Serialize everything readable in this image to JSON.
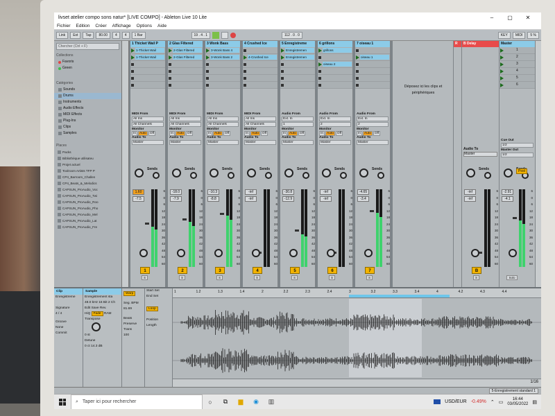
{
  "window": {
    "title": "livset atelier compo sons natur* [LIVE COMPO] - Ableton Live 10 Lite",
    "minimize": "–",
    "maximize": "▢",
    "close": "✕"
  },
  "menu": [
    "Fichier",
    "Edition",
    "Créer",
    "Affichage",
    "Options",
    "Aide"
  ],
  "control_bar": {
    "link": "Link",
    "ext": "Ext",
    "tap": "Tap",
    "tempo": "80.00",
    "sig_num": "4",
    "sig_den": "4",
    "quant": "1 Bar",
    "position": "19 . 4 . 1",
    "loop_start": "112 . 0 . 0",
    "key": "KEY",
    "midi": "MIDI",
    "cpu": "5 %"
  },
  "browser": {
    "search_placeholder": "Chercher (Ctrl + F)",
    "collections_label": "Collections",
    "collections": [
      {
        "label": "Favoris",
        "color": "#e04646"
      },
      {
        "label": "Green",
        "color": "#3cbf4a"
      }
    ],
    "categories_label": "Catégories",
    "categories": [
      "Sounds",
      "Drums",
      "Instruments",
      "Audio Effects",
      "MIDI Effects",
      "Plug-Ins",
      "Clips",
      "Samples"
    ],
    "selected_category": "Drums",
    "places_label": "Places",
    "places": [
      "Packs",
      "Bibliothèque utilisateu",
      "Projet actuel",
      "Toolroom Artists TFP P",
      "CP4_Barroom_Challen",
      "CP4_Beats_&_Melodics",
      "CAPSUN_ProAudio_Voc",
      "CAPSUN_ProAudio_Twi",
      "CAPSUN_ProAudio_Roo",
      "CAPSUN_ProAudio_Pho",
      "CAPSUN_ProAudio_Mel",
      "CAPSUN_ProAudio_Lat",
      "CAPSUN_ProAudio_Fre"
    ]
  },
  "tracks": [
    {
      "name": "1 Thicket Wail P",
      "color": "#8ccbe8",
      "clips": [
        "1-Thicket Wail",
        "1-Thicket Wail"
      ],
      "io_label": "MIDI From",
      "io_from": "All Ins",
      "io_ch": "All Channels",
      "vol": "1.60",
      "vol2": "-7.5",
      "num": "1",
      "meter": 0.52
    },
    {
      "name": "2 Glas Filtered",
      "color": "#8ccbe8",
      "clips": [
        "2-Glas Filtered",
        "2-Glas Filtered"
      ],
      "io_label": "MIDI From",
      "io_from": "All Ins",
      "io_ch": "All Channels",
      "vol": "-18.0",
      "vol2": "-7.9",
      "num": "2",
      "meter": 0.58
    },
    {
      "name": "3 Wonk Bass",
      "color": "#8ccbe8",
      "clips": [
        "3-Wonk Bass 4",
        "3-Wonk Bass 2"
      ],
      "io_label": "MIDI From",
      "io_from": "All Ins",
      "io_ch": "All Channels",
      "vol": "-10.3",
      "vol2": "-8.8",
      "num": "3",
      "meter": 0.66
    },
    {
      "name": "4 Crushed Ice",
      "color": "#8ccbe8",
      "clips": [
        "",
        "4-Crushed Ice"
      ],
      "io_label": "MIDI From",
      "io_from": "All Ins",
      "io_ch": "All Channels",
      "vol": "-inf",
      "vol2": "-inf",
      "num": "4",
      "meter": 0
    },
    {
      "name": "5 Enregistreme",
      "color": "#8ccbe8",
      "clips": [
        "Enregistremen",
        "Enregistremen"
      ],
      "io_label": "Audio From",
      "io_from": "Ext. In",
      "io_ch": "1",
      "vol": "-30.8",
      "vol2": "-12.9",
      "num": "5",
      "meter": 0.42
    },
    {
      "name": "6 grillons",
      "color": "#8ccbe8",
      "clips": [
        "grillons",
        "",
        "oiseau 2"
      ],
      "io_label": "Audio From",
      "io_from": "Ext. In",
      "io_ch": "2",
      "vol": "-inf",
      "vol2": "-inf",
      "num": "6",
      "meter": 0
    },
    {
      "name": "7 oiseau 1",
      "color": "#8ccbe8",
      "clips": [
        "",
        "oiseau 1"
      ],
      "io_label": "Audio From",
      "io_from": "Ext. In",
      "io_ch": "2",
      "vol": "-4.65",
      "vol2": "-3.4",
      "num": "7",
      "meter": 0.7
    }
  ],
  "drop_hint": "Déposez ici les clips et périphériques",
  "returns": [
    {
      "name": "B Delay",
      "color": "#e84b4b",
      "vol": "-inf",
      "vol2": "-inf",
      "letter": "B"
    },
    {
      "name": "Master",
      "color": "#8ccbe8",
      "vol": "-2.91",
      "vol2": "-4.1",
      "letter": ""
    }
  ],
  "monitor": {
    "label": "Monitor",
    "in": "In",
    "auto": "Auto",
    "off": "Off",
    "audio_to": "Audio To",
    "master": "Master",
    "sends": "Sends",
    "s": "S"
  },
  "scale": [
    "6",
    "0",
    "6",
    "12",
    "18",
    "24",
    "30",
    "36",
    "42",
    "48",
    "54",
    "60"
  ],
  "master_extra": {
    "cue_out": "Cue Out",
    "cue_val": "1/2",
    "master_out": "Master Out",
    "master_val": "1/2",
    "post": "Post",
    "solo": "Solo",
    "scenes": [
      "1",
      "2",
      "3",
      "4",
      "5",
      "6"
    ]
  },
  "detail": {
    "clip_head": "Clip",
    "clip_name": "Enregistreme",
    "signature": "Signature",
    "sig": "4 / 4",
    "groove": "Groove",
    "groove_val": "None",
    "commit": "Commit",
    "sample_head": "Sample",
    "sample_name": "Enregistrement sta",
    "sample_info": "48.0 kHz 16 Bit 2 Ch",
    "edit": "Edit",
    "save": "Save",
    "rev": "Rev.",
    "hiq": "HiQ",
    "fade": "Fade",
    "ram": "RAM",
    "transpose": "Transpose",
    "st": "0 st",
    "detune": "Detune",
    "ct": "0 ct",
    "gain": "14.3 dB",
    "warp": "Warp",
    "seg_bpm": "Seg. BPM",
    "bpm": "81.69",
    "beats": "Beats",
    "preserve": "Preserve",
    "trans": "Trans",
    "val100": "100",
    "start": "Start",
    "end": "End",
    "loop": "Loop",
    "position": "Position",
    "length": "Length",
    "set": "Set"
  },
  "ruler": [
    "1",
    "1.2",
    "1.3",
    "1.4",
    "2",
    "2.2",
    "2.3",
    "2.4",
    "3",
    "3.2",
    "3.3",
    "3.4",
    "4",
    "4.2",
    "4.3",
    "4.4"
  ],
  "page_indicator": "1/16",
  "status": "5-Enregistrement standard 1",
  "taskbar": {
    "search": "Taper ici pour rechercher",
    "ticker": "USD/EUR",
    "change": "-0.49%",
    "time": "16:44",
    "date": "03/05/2022"
  }
}
